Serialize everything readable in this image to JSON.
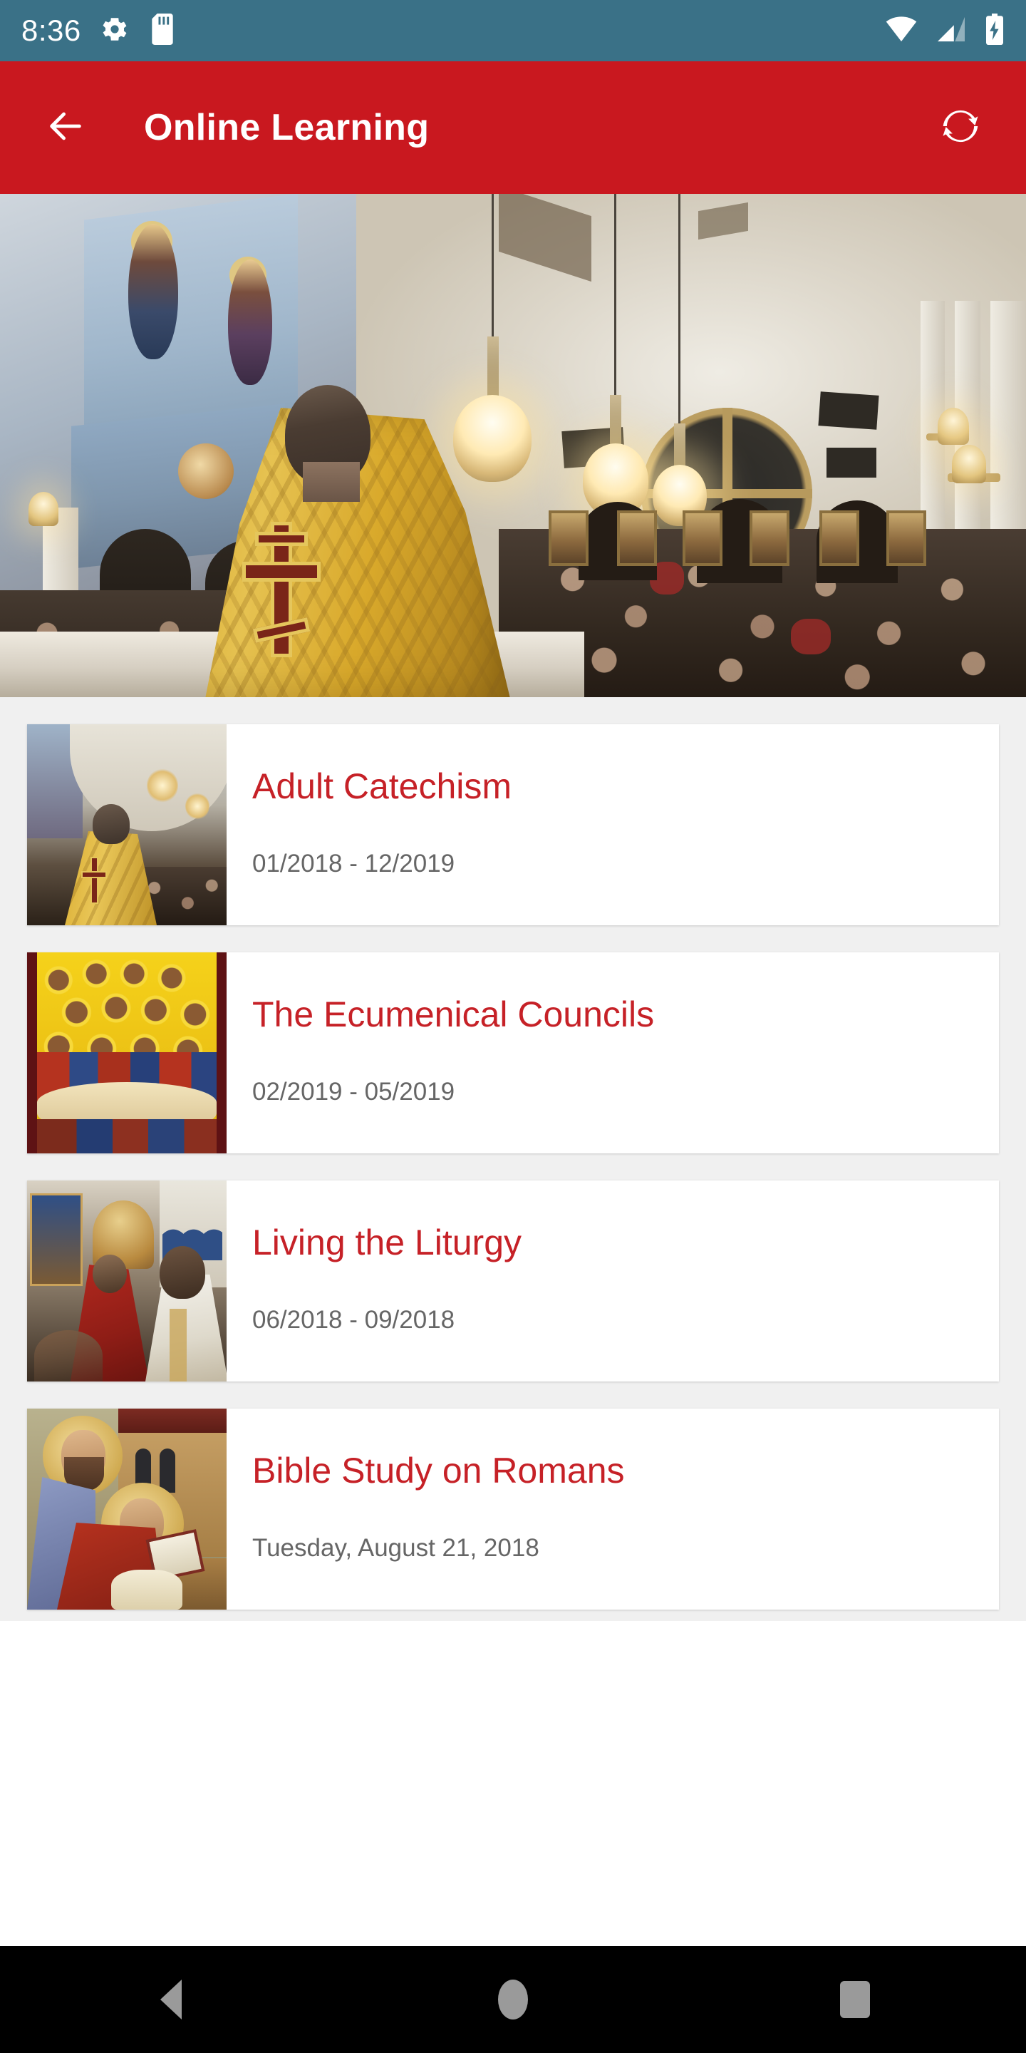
{
  "status_bar": {
    "time": "8:36",
    "background_color": "#3a7187",
    "left_icons": [
      "gear-icon",
      "sd-card-icon"
    ],
    "right_icons": [
      "wifi-icon",
      "cellular-signal-icon",
      "battery-charging-icon"
    ]
  },
  "app_bar": {
    "title": "Online Learning",
    "background_color": "#c9181f",
    "back_icon": "back-arrow-icon",
    "action_icon": "refresh-sync-icon"
  },
  "hero": {
    "alt": "Orthodox priest in gold vestments facing congregation inside church",
    "visible": true
  },
  "list": {
    "title_color": "#c62127",
    "subtitle_color": "#666666",
    "items": [
      {
        "title": "Adult Catechism",
        "subtitle": "01/2018 - 12/2019",
        "thumbnail": "priest-gold-vestments-thumbnail"
      },
      {
        "title": "The Ecumenical Councils",
        "subtitle": "02/2019 - 05/2019",
        "thumbnail": "ecumenical-council-icon-thumbnail"
      },
      {
        "title": "Living the Liturgy",
        "subtitle": "06/2018 - 09/2018",
        "thumbnail": "liturgy-altar-servers-thumbnail"
      },
      {
        "title": "Bible Study on Romans",
        "subtitle": "Tuesday, August 21, 2018",
        "thumbnail": "apostle-paul-writing-icon-thumbnail"
      }
    ]
  },
  "navigation_bar": {
    "background_color": "#000000",
    "buttons": [
      "back-triangle-icon",
      "home-circle-icon",
      "recents-square-icon"
    ]
  }
}
